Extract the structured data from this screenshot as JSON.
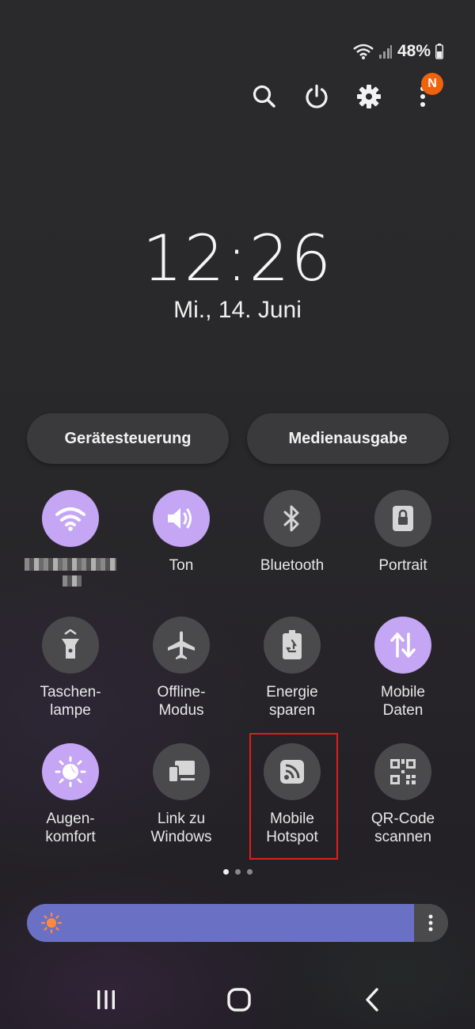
{
  "status": {
    "battery": "48%"
  },
  "top_actions": {
    "notification_badge": "N"
  },
  "lockclock": {
    "time": "12:26",
    "date": "Mi., 14. Juni"
  },
  "pills": {
    "device_control": "Gerätesteuerung",
    "media_output": "Medienausgabe"
  },
  "tiles": [
    {
      "label": "",
      "icon": "wifi-icon",
      "active": true
    },
    {
      "label": "Ton",
      "icon": "speaker-icon",
      "active": true
    },
    {
      "label": "Bluetooth",
      "icon": "bluetooth-icon",
      "active": false
    },
    {
      "label": "Portrait",
      "icon": "rotation-lock-icon",
      "active": false
    },
    {
      "label": "Taschen-\nlampe",
      "icon": "flashlight-icon",
      "active": false
    },
    {
      "label": "Offline-\nModus",
      "icon": "airplane-icon",
      "active": false
    },
    {
      "label": "Energie\nsparen",
      "icon": "power-saving-icon",
      "active": false
    },
    {
      "label": "Mobile\nDaten",
      "icon": "mobile-data-icon",
      "active": true
    },
    {
      "label": "Augen-\nkomfort",
      "icon": "eye-comfort-icon",
      "active": true
    },
    {
      "label": "Link zu\nWindows",
      "icon": "link-to-windows-icon",
      "active": false
    },
    {
      "label": "Mobile\nHotspot",
      "icon": "hotspot-icon",
      "active": false
    },
    {
      "label": "QR-Code\nscannen",
      "icon": "qr-code-icon",
      "active": false
    }
  ],
  "pager": {
    "count": 3,
    "active": 0
  },
  "brightness": {
    "level": 0.92
  },
  "colors": {
    "accent": "#c4a6f5",
    "tile_off": "#4a4a4c",
    "brightness": "#6a71c4",
    "badge": "#f0620b",
    "highlight": "#e01d1d"
  }
}
